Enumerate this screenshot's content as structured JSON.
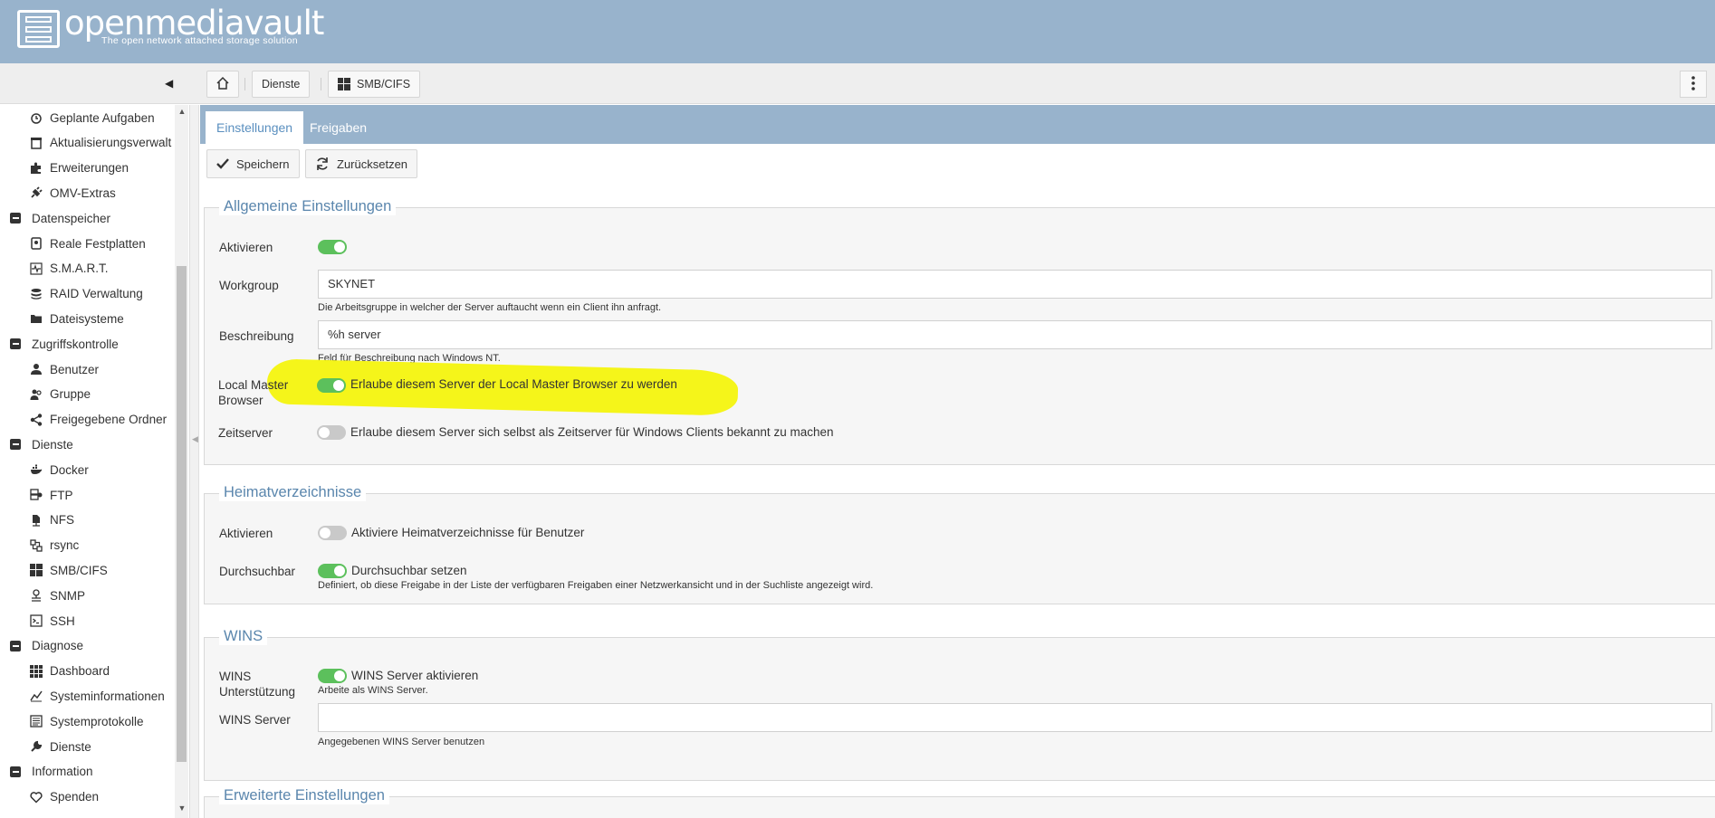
{
  "brand": {
    "name": "openmediavault",
    "tagline": "The open network attached storage solution"
  },
  "breadcrumb": [
    "Dienste",
    "SMB/CIFS"
  ],
  "sidebar": {
    "items": [
      {
        "type": "child",
        "label": "Geplante Aufgaben",
        "icon": "alarm-clock-icon"
      },
      {
        "type": "child",
        "label": "Aktualisierungsverwalt",
        "icon": "package-update-icon"
      },
      {
        "type": "child",
        "label": "Erweiterungen",
        "icon": "puzzle-icon"
      },
      {
        "type": "child",
        "label": "OMV-Extras",
        "icon": "plug-icon"
      },
      {
        "type": "group",
        "label": "Datenspeicher"
      },
      {
        "type": "child",
        "label": "Reale Festplatten",
        "icon": "harddisk-icon"
      },
      {
        "type": "child",
        "label": "S.M.A.R.T.",
        "icon": "pulse-icon"
      },
      {
        "type": "child",
        "label": "RAID Verwaltung",
        "icon": "database-icon"
      },
      {
        "type": "child",
        "label": "Dateisysteme",
        "icon": "folder-icon"
      },
      {
        "type": "group",
        "label": "Zugriffskontrolle"
      },
      {
        "type": "child",
        "label": "Benutzer",
        "icon": "user-icon"
      },
      {
        "type": "child",
        "label": "Gruppe",
        "icon": "users-icon"
      },
      {
        "type": "child",
        "label": "Freigegebene Ordner",
        "icon": "share-icon"
      },
      {
        "type": "group",
        "label": "Dienste"
      },
      {
        "type": "child",
        "label": "Docker",
        "icon": "docker-whale-icon"
      },
      {
        "type": "child",
        "label": "FTP",
        "icon": "ftp-server-icon"
      },
      {
        "type": "child",
        "label": "NFS",
        "icon": "nfs-file-icon"
      },
      {
        "type": "child",
        "label": "rsync",
        "icon": "sync-icon"
      },
      {
        "type": "child",
        "label": "SMB/CIFS",
        "icon": "windows-icon"
      },
      {
        "type": "child",
        "label": "SNMP",
        "icon": "network-icon"
      },
      {
        "type": "child",
        "label": "SSH",
        "icon": "console-icon"
      },
      {
        "type": "group",
        "label": "Diagnose"
      },
      {
        "type": "child",
        "label": "Dashboard",
        "icon": "grid-dashboard-icon"
      },
      {
        "type": "child",
        "label": "Systeminformationen",
        "icon": "chart-line-icon"
      },
      {
        "type": "child",
        "label": "Systemprotokolle",
        "icon": "log-list-icon"
      },
      {
        "type": "child",
        "label": "Dienste",
        "icon": "wrench-icon"
      },
      {
        "type": "group",
        "label": "Information"
      },
      {
        "type": "child",
        "label": "Spenden",
        "icon": "heart-icon"
      }
    ]
  },
  "tabs": [
    {
      "label": "Einstellungen",
      "active": true
    },
    {
      "label": "Freigaben",
      "active": false
    }
  ],
  "actions": {
    "save": "Speichern",
    "reset": "Zurücksetzen"
  },
  "general": {
    "legend": "Allgemeine Einstellungen",
    "enable_label": "Aktivieren",
    "enable_on": true,
    "workgroup_label": "Workgroup",
    "workgroup_value": "SKYNET",
    "workgroup_hint": "Die Arbeitsgruppe in welcher der Server auftaucht wenn ein Client ihn anfragt.",
    "description_label": "Beschreibung",
    "description_value": "%h server",
    "description_hint": "Feld für Beschreibung nach Windows NT.",
    "lmb_label_1": "Local Master",
    "lmb_label_2": "Browser",
    "lmb_on": true,
    "lmb_text": "Erlaube diesem Server der Local Master Browser zu werden",
    "timeserver_label": "Zeitserver",
    "timeserver_on": false,
    "timeserver_text": "Erlaube diesem Server sich selbst als Zeitserver für Windows Clients bekannt zu machen"
  },
  "homes": {
    "legend": "Heimatverzeichnisse",
    "enable_label": "Aktivieren",
    "enable_on": false,
    "enable_text": "Aktiviere Heimatverzeichnisse für Benutzer",
    "browsable_label": "Durchsuchbar",
    "browsable_on": true,
    "browsable_text": "Durchsuchbar setzen",
    "browsable_hint": "Definiert, ob diese Freigabe in der Liste der verfügbaren Freigaben einer Netzwerkansicht und in der Suchliste angezeigt wird."
  },
  "wins": {
    "legend": "WINS",
    "support_label_1": "WINS",
    "support_label_2": "Unterstützung",
    "support_on": true,
    "support_text": "WINS Server aktivieren",
    "support_hint": "Arbeite als WINS Server.",
    "server_label": "WINS Server",
    "server_value": "",
    "server_hint": "Angegebenen WINS Server benutzen"
  },
  "advanced": {
    "legend": "Erweiterte Einstellungen"
  },
  "colors": {
    "header": "#98b3cc",
    "toggle_on": "#5cc05c",
    "toggle_off": "#c9c9c9",
    "legend": "#5a86ad",
    "highlight": "#f4f40e"
  }
}
